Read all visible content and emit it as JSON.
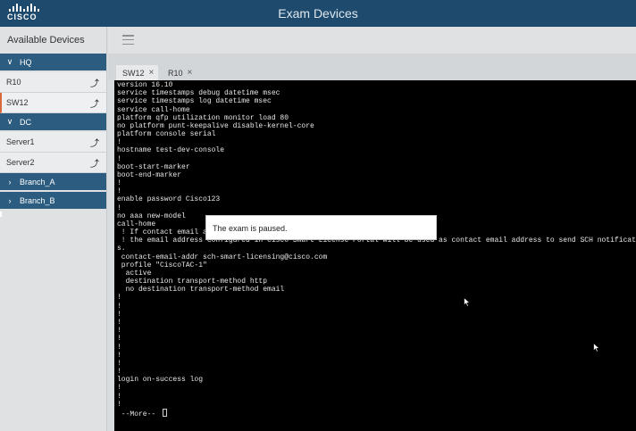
{
  "header": {
    "logo_text": "CISCO",
    "title": "Exam Devices",
    "colors": {
      "bar": "#1e4a6d",
      "accent": "#d9683b"
    }
  },
  "sidebar": {
    "title": "Available Devices",
    "groups": [
      {
        "label": "HQ",
        "expanded": true,
        "icon": "chevron-down-icon",
        "devices": [
          {
            "label": "R10",
            "icon": "expand-arrow-icon"
          },
          {
            "label": "SW12",
            "icon": "expand-arrow-icon",
            "selected": true
          }
        ]
      },
      {
        "label": "DC",
        "expanded": true,
        "icon": "chevron-down-icon",
        "devices": [
          {
            "label": "Server1",
            "icon": "expand-arrow-icon"
          },
          {
            "label": "Server2",
            "icon": "expand-arrow-icon"
          }
        ]
      },
      {
        "label": "Branch_A",
        "expanded": false,
        "icon": "chevron-right-icon",
        "devices": []
      },
      {
        "label": "Branch_B",
        "expanded": false,
        "icon": "chevron-right-icon",
        "devices": []
      }
    ]
  },
  "tabs": [
    {
      "label": "SW12",
      "close": "×",
      "active": true
    },
    {
      "label": "R10",
      "close": "×",
      "active": false
    }
  ],
  "terminal": {
    "lines": [
      "version 16.10",
      "service timestamps debug datetime msec",
      "service timestamps log datetime msec",
      "service call-home",
      "platform qfp utilization monitor load 80",
      "no platform punt-keepalive disable-kernel-core",
      "platform console serial",
      "!",
      "hostname test-dev-console",
      "!",
      "boot-start-marker",
      "boot-end-marker",
      "!",
      "!",
      "enable password Cisco123",
      "!",
      "no aaa new-model",
      "call-home",
      " ! If contact email a                                         cisco.com",
      " ! the email address configured in Cisco Smart License Portal will be used as contact email address to send SCH notification",
      "s.",
      " contact-email-addr sch-smart-licensing@cisco.com",
      " profile \"CiscoTAC-1\"",
      "  active",
      "  destination transport-method http",
      "  no destination transport-method email",
      "!",
      "!",
      "!",
      "!",
      "!",
      "!",
      "!",
      "!",
      "!",
      "!",
      "login on-success log",
      "!",
      "!",
      "!"
    ],
    "more_prompt": " --More-- "
  },
  "modal": {
    "message": "The exam is paused."
  }
}
